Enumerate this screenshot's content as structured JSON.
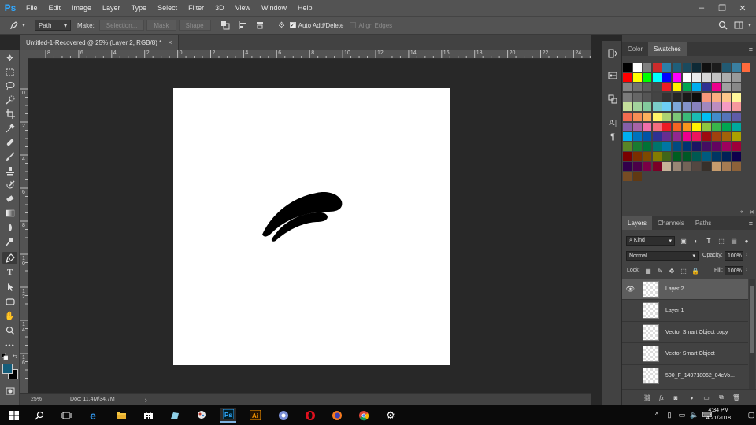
{
  "menubar": {
    "logo": "Ps",
    "items": [
      "File",
      "Edit",
      "Image",
      "Layer",
      "Type",
      "Select",
      "Filter",
      "3D",
      "View",
      "Window",
      "Help"
    ],
    "controls": [
      "–",
      "❐",
      "✕"
    ]
  },
  "options": {
    "mode_value": "Path",
    "make_label": "Make:",
    "selection_label": "Selection...",
    "mask_label": "Mask",
    "shape_label": "Shape",
    "auto_add_label": "Auto Add/Delete",
    "align_edges_label": "Align Edges",
    "auto_add_checked": "✓"
  },
  "document": {
    "tab_title": "Untitled-1-Recovered @ 25% (Layer 2, RGB/8) *",
    "tab_close": "×",
    "zoom": "25%",
    "doc_size": "Doc: 11.4M/34.7M",
    "status_arrow": "›"
  },
  "rulers": {
    "top": [
      "8",
      "6",
      "4",
      "2",
      "0",
      "2",
      "4",
      "6",
      "8",
      "10",
      "12",
      "14",
      "16",
      "18",
      "20",
      "22",
      "24"
    ],
    "left": [
      "0",
      "2",
      "4",
      "6",
      "8",
      "1 0",
      "1 2",
      "1 4",
      "1 6"
    ]
  },
  "color_panel": {
    "tabs": [
      "Color",
      "Swatches"
    ],
    "active_tab": "Swatches",
    "menu": "≡",
    "swatch_colors": [
      [
        "#000000",
        "#ffffff",
        "#808080",
        "#cc2b2b",
        "#2a7fa8",
        "#1e5f7a",
        "#1a4a5e",
        "#0e2a36",
        "#101010",
        "#1c1c1c",
        "#225a72",
        "#3a7fa0",
        "#ff6a3c"
      ],
      [
        "#ff0000",
        "#ffff00",
        "#00ff00",
        "#00ffff",
        "#0000ff",
        "#ff00ff",
        "#ffffff",
        "#ebebeb",
        "#d6d6d6",
        "#c2c2c2",
        "#adadad",
        "#999999"
      ],
      [
        "#858585",
        "#707070",
        "#5c5c5c",
        "#474747",
        "#ed1c24",
        "#fff200",
        "#00a651",
        "#00aeef",
        "#2e3192",
        "#ec008c",
        "#a0a0a0",
        "#888888"
      ],
      [
        "#7a7a7a",
        "#666666",
        "#555555",
        "#444444",
        "#333333",
        "#262626",
        "#1a1a1a",
        "#0d0d0d",
        "#f7977a",
        "#f9ad81",
        "#fdc68a",
        "#fff79a"
      ],
      [
        "#c4df9b",
        "#a2d39c",
        "#82ca9c",
        "#7accc8",
        "#6dcff6",
        "#7da7d9",
        "#8393ca",
        "#8781bd",
        "#a187be",
        "#bc8dbf",
        "#f49ac2",
        "#f6989d"
      ],
      [
        "#f26c4f",
        "#f68e55",
        "#fbaf5c",
        "#fff467",
        "#acd372",
        "#7cc576",
        "#3bb878",
        "#1abbb4",
        "#00bff3",
        "#438ccb",
        "#5574b9",
        "#605ca8"
      ],
      [
        "#855fa8",
        "#a763a8",
        "#f06eaa",
        "#f26d7d",
        "#ed1c24",
        "#f26522",
        "#f7941d",
        "#fff200",
        "#8dc73f",
        "#39b54a",
        "#00a651",
        "#00a99d"
      ],
      [
        "#00aeef",
        "#0072bc",
        "#0054a6",
        "#2e3192",
        "#662d91",
        "#92278f",
        "#ec008c",
        "#ed145b",
        "#9e0b0f",
        "#a0410d",
        "#a36209",
        "#aba000"
      ],
      [
        "#598527",
        "#197b30",
        "#007236",
        "#00746b",
        "#0076a3",
        "#004b80",
        "#003471",
        "#1b1464",
        "#440e62",
        "#630460",
        "#9e005d",
        "#9e0039"
      ],
      [
        "#790000",
        "#7b2e00",
        "#7d4900",
        "#827b00",
        "#406618",
        "#005e20",
        "#005826",
        "#005952",
        "#005b7f",
        "#003663",
        "#002157",
        "#0d004c"
      ],
      [
        "#32004b",
        "#4b0049",
        "#7b0046",
        "#7a0026",
        "#c7b299",
        "#998675",
        "#736357",
        "#534741",
        "#37302a",
        "#c69c6d",
        "#a67c52",
        "#8c6239"
      ],
      [
        "#754c24",
        "#603913"
      ]
    ]
  },
  "layers_panel": {
    "tabs": [
      "Layers",
      "Channels",
      "Paths"
    ],
    "active_tab": "Layers",
    "menu": "≡",
    "filter_value": "Kind",
    "blend_mode": "Normal",
    "opacity_label": "Opacity:",
    "opacity_value": "100%",
    "lock_label": "Lock:",
    "fill_label": "Fill:",
    "fill_value": "100%",
    "layers": [
      {
        "name": "Layer 2",
        "selected": true,
        "visible": true
      },
      {
        "name": "Layer 1",
        "selected": false,
        "visible": false
      },
      {
        "name": "Vector Smart Object copy",
        "selected": false,
        "visible": false
      },
      {
        "name": "Vector Smart Object",
        "selected": false,
        "visible": false
      },
      {
        "name": "500_F_149718062_04cVo...",
        "selected": false,
        "visible": false
      }
    ],
    "eye_glyph": "👁",
    "footer_icons": [
      "link-icon",
      "fx-icon",
      "mask-icon",
      "adjustment-icon",
      "folder-icon",
      "new-layer-icon",
      "trash-icon"
    ],
    "footer_fx": "fx"
  },
  "taskbar": {
    "time": "4:34 PM",
    "date": "4/21/2018"
  }
}
